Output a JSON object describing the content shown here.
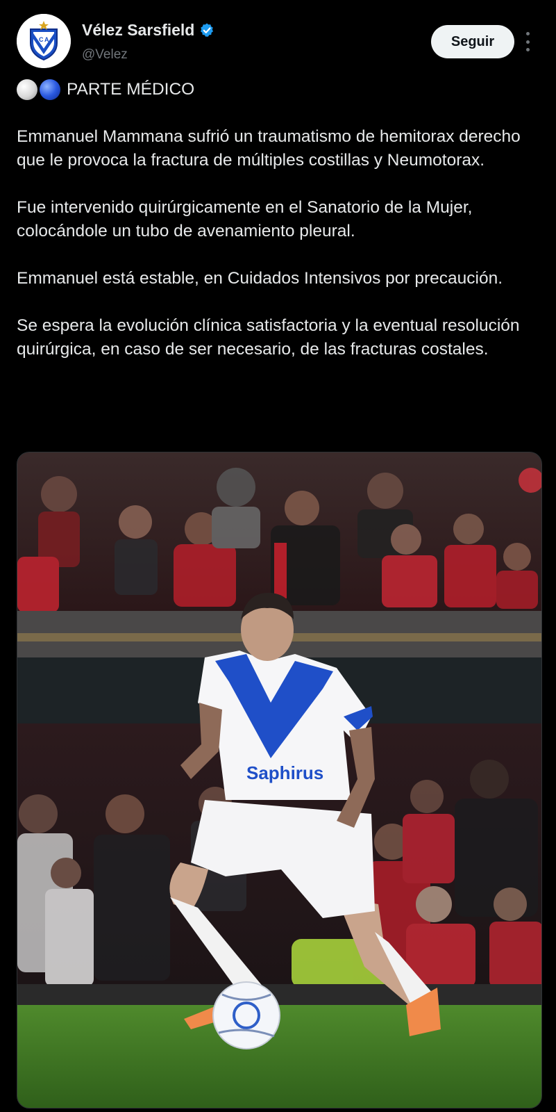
{
  "author": {
    "display_name": "Vélez Sarsfield",
    "handle": "@Velez",
    "avatar_icon": "velez-crest-icon",
    "verified_icon": "verified-badge-icon",
    "verified_color": "#1d9bf0"
  },
  "actions": {
    "follow_label": "Seguir",
    "more_icon": "more-vertical-icon"
  },
  "tweet": {
    "emoji_icons": [
      "white-circle-icon",
      "blue-circle-icon"
    ],
    "title": "PARTE MÉDICO",
    "paragraphs": [
      "Emmanuel Mammana sufrió un traumatismo de hemitorax derecho que le provoca la fractura de múltiples costillas y Neumotorax.",
      "Fue intervenido quirúrgicamente en el Sanatorio de la Mujer, colocándole un tubo de avenamiento pleural.",
      "Emmanuel está estable, en Cuidados Intensivos por precaución.",
      "Se espera la evolución clínica satisfactoria y la eventual resolución quirúrgica, en caso de ser necesario, de las fracturas costales."
    ]
  },
  "media": {
    "type": "photo",
    "shirt_sponsor": "Saphirus"
  },
  "colors": {
    "background": "#000000",
    "text": "#e7e9ea",
    "secondary_text": "#71767b",
    "follow_button_bg": "#eff3f4"
  }
}
